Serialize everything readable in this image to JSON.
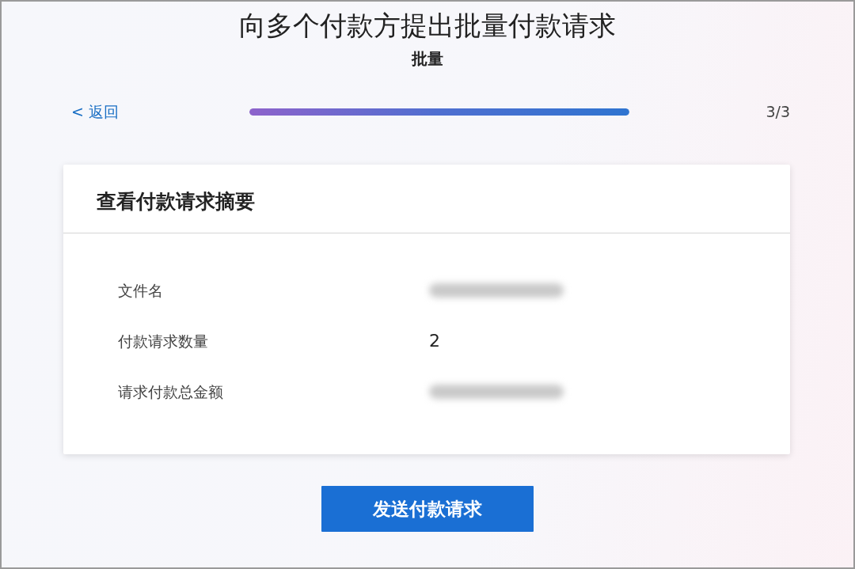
{
  "title": "向多个付款方提出批量付款请求",
  "subtitle": "批量",
  "back_link": "< 返回",
  "progress": {
    "level": 1,
    "step": "3/3"
  },
  "summary_card": {
    "title": "查看付款请求摘要",
    "rows": [
      {
        "label": "文件名",
        "kind": "redacted"
      },
      {
        "label": "付款请求数量",
        "kind": "text",
        "value": "2"
      },
      {
        "label": "请求付款总金额",
        "kind": "redacted"
      }
    ]
  },
  "submit_button": "发送付款请求"
}
